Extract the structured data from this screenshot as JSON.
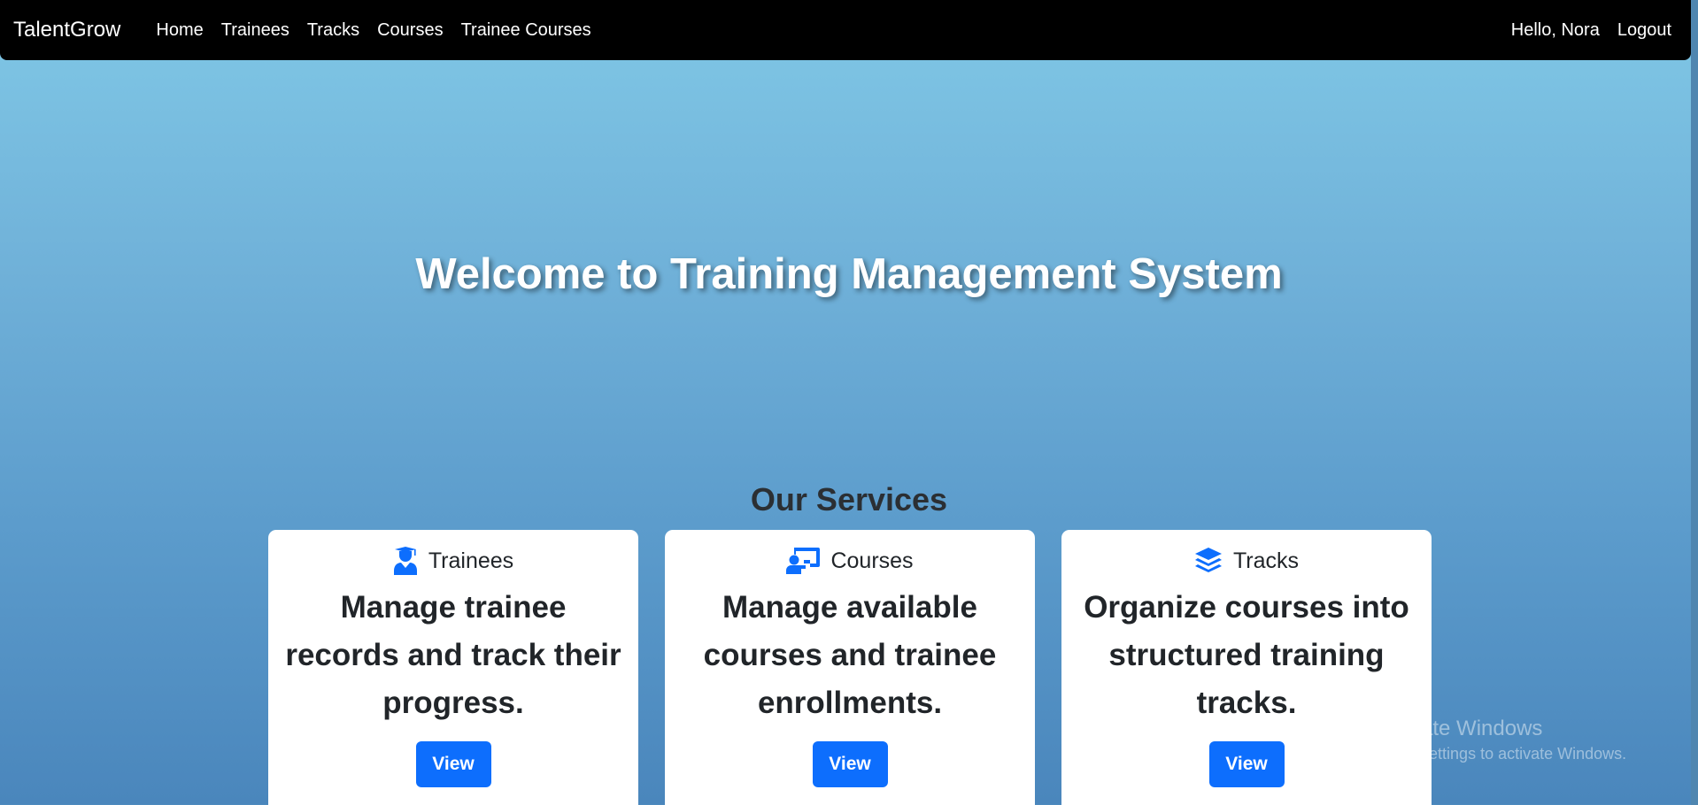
{
  "navbar": {
    "brand": "TalentGrow",
    "links": [
      "Home",
      "Trainees",
      "Tracks",
      "Courses",
      "Trainee Courses"
    ],
    "greeting": "Hello, Nora",
    "logout": "Logout"
  },
  "hero": {
    "title": "Welcome to Training Management System"
  },
  "services": {
    "title": "Our Services",
    "cards": [
      {
        "icon": "graduate-user-icon",
        "label": "Trainees",
        "description": "Manage trainee records and track their progress.",
        "button": "View"
      },
      {
        "icon": "chalkboard-teacher-icon",
        "label": "Courses",
        "description": "Manage available courses and trainee enrollments.",
        "button": "View"
      },
      {
        "icon": "layers-icon",
        "label": "Tracks",
        "description": "Organize courses into structured training tracks.",
        "button": "View"
      }
    ]
  },
  "watermark": {
    "title": "Activate Windows",
    "subtitle": "Go to Settings to activate Windows."
  },
  "colors": {
    "navbar": "#000000",
    "primary_button": "#0d6efd",
    "icon": "#0d6efd",
    "gradient_top": "#80c8e6",
    "gradient_bottom": "#4a86bc"
  }
}
